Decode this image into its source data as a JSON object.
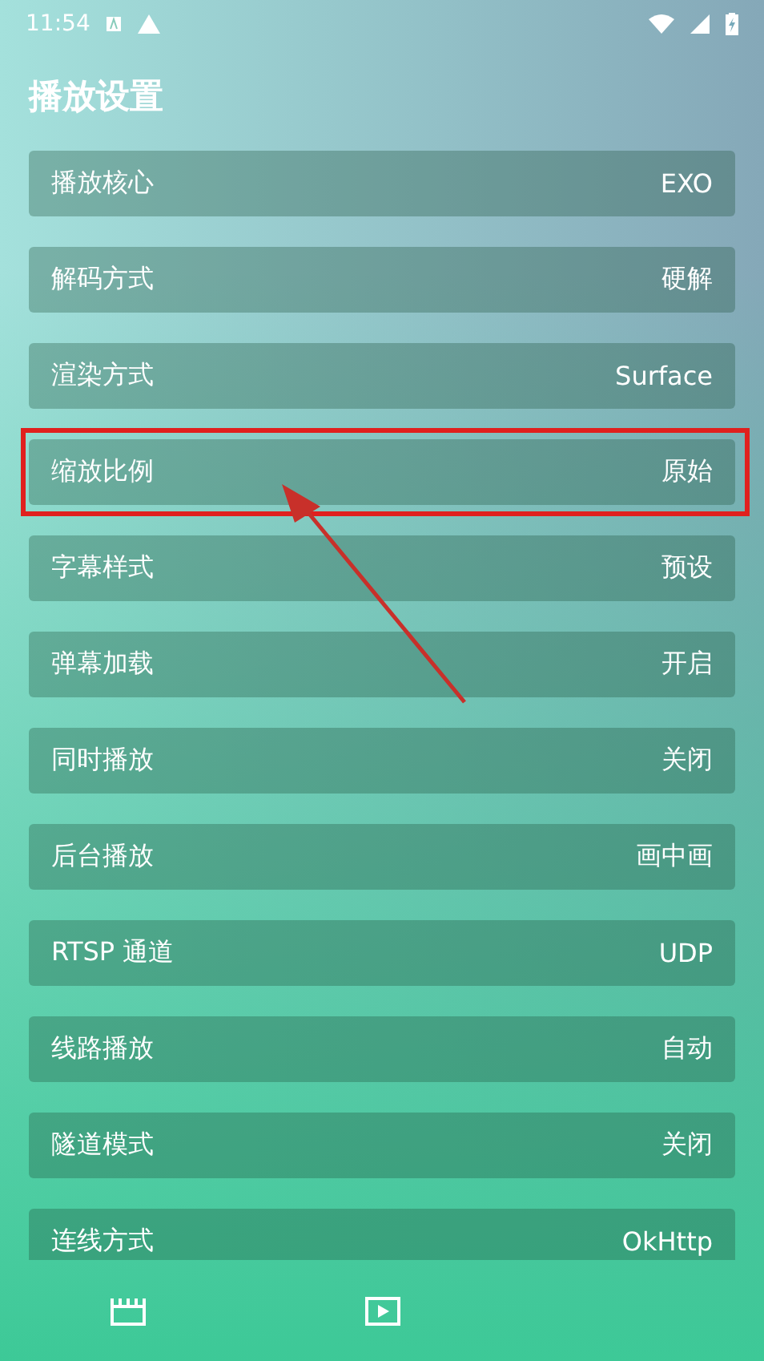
{
  "status_bar": {
    "time": "11:54"
  },
  "title": "播放设置",
  "settings": [
    {
      "label": "播放核心",
      "value": "EXO",
      "highlighted": false
    },
    {
      "label": "解码方式",
      "value": "硬解",
      "highlighted": false
    },
    {
      "label": "渲染方式",
      "value": "Surface",
      "highlighted": false
    },
    {
      "label": "缩放比例",
      "value": "原始",
      "highlighted": true
    },
    {
      "label": "字幕样式",
      "value": "预设",
      "highlighted": false
    },
    {
      "label": "弹幕加载",
      "value": "开启",
      "highlighted": false
    },
    {
      "label": "同时播放",
      "value": "关闭",
      "highlighted": false
    },
    {
      "label": "后台播放",
      "value": "画中画",
      "highlighted": false
    },
    {
      "label": "RTSP 通道",
      "value": "UDP",
      "highlighted": false
    },
    {
      "label": "线路播放",
      "value": "自动",
      "highlighted": false
    },
    {
      "label": "隧道模式",
      "value": "关闭",
      "highlighted": false
    },
    {
      "label": "连线方式",
      "value": "OkHttp",
      "highlighted": false
    }
  ],
  "bottom_nav": [
    {
      "kind": "film"
    },
    {
      "kind": "play"
    }
  ]
}
